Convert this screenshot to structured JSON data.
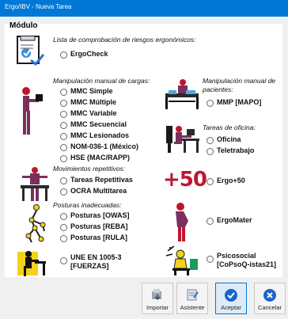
{
  "window": {
    "title": "Ergo/IBV - Nueva Tarea"
  },
  "section": {
    "title": "Módulo"
  },
  "groups": {
    "checklist": {
      "label": "Lista de comprobación de riesgos ergonómicos:",
      "options": [
        "ErgoCheck"
      ]
    },
    "manual_loads": {
      "label": "Manipulación manual de cargas:",
      "options": [
        "MMC Simple",
        "MMC Múltiple",
        "MMC Variable",
        "MMC Secuencial",
        "MMC Lesionados",
        "NOM-036-1 (México)",
        "HSE (MAC/RAPP)"
      ]
    },
    "manual_patients": {
      "label": "Manipulación manual de pacientes:",
      "options": [
        "MMP [MAPO]"
      ]
    },
    "office": {
      "label": "Tareas de oficina:",
      "options": [
        "Oficina",
        "Teletrabajo"
      ]
    },
    "repetitive": {
      "label": "Movimientos repetitivos:",
      "options": [
        "Tareas Repetitivas",
        "OCRA Multitarea"
      ]
    },
    "ergo50": {
      "options": [
        "Ergo+50"
      ],
      "badge": "+50"
    },
    "postures": {
      "label": "Posturas inadecuadas:",
      "options": [
        "Posturas [OWAS]",
        "Posturas [REBA]",
        "Posturas [RULA]"
      ]
    },
    "ergomater": {
      "options": [
        "ErgoMater"
      ]
    },
    "forces": {
      "options": [
        "UNE EN 1005-3 [FUERZAS]"
      ]
    },
    "psychosocial": {
      "options": [
        "Psicosocial [CoPsoQ-istas21]"
      ]
    }
  },
  "buttons": {
    "import": "Importar",
    "wizard": "Asistente",
    "accept": "Aceptar",
    "cancel": "Cancelar"
  },
  "colors": {
    "titlebar": "#0078d7",
    "figure": "#7b2f5b",
    "accent_red": "#c0152f",
    "yellow": "#f2d21a",
    "blue": "#1a64c8"
  }
}
